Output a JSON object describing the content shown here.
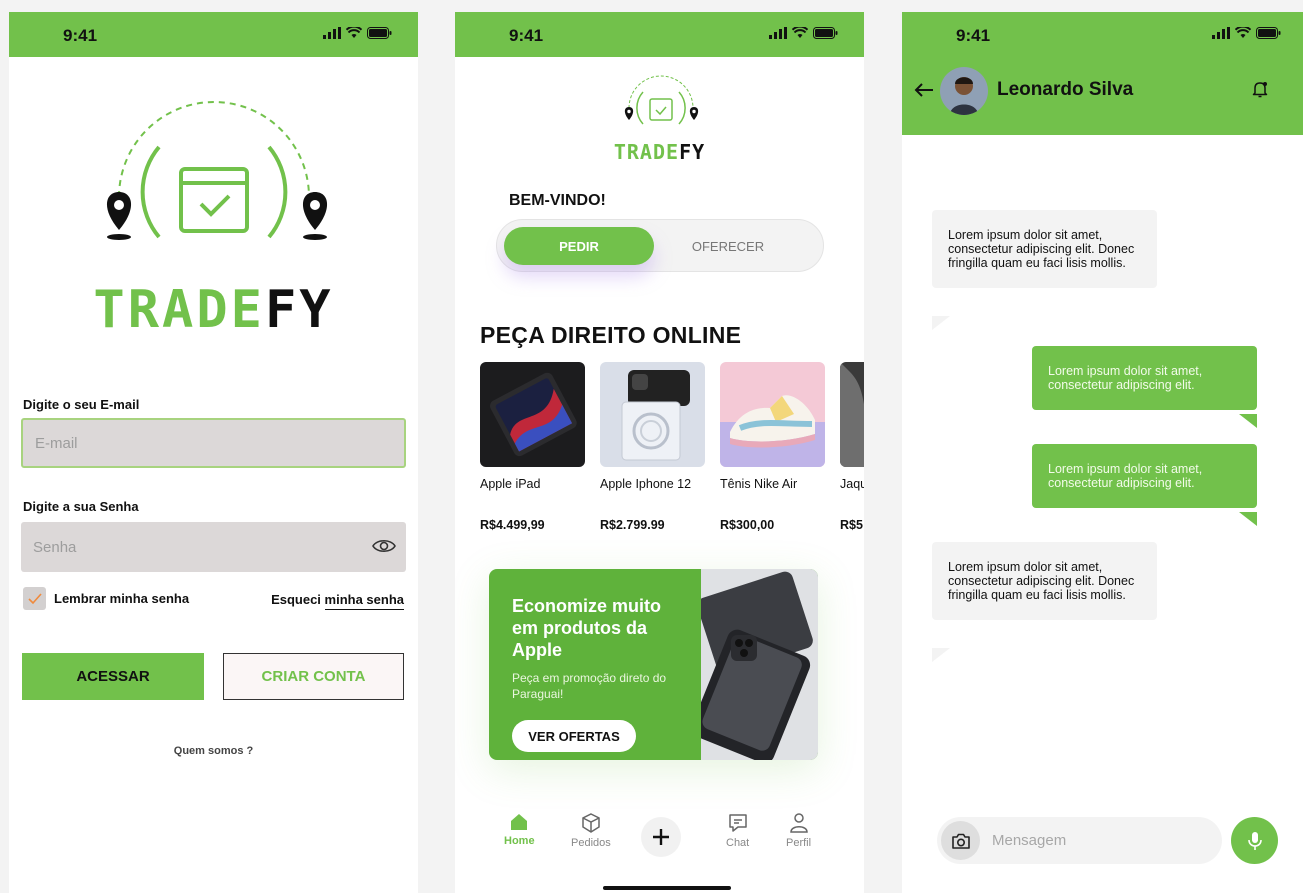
{
  "status_bar": {
    "time": "9:41"
  },
  "brand": {
    "part1": "TRADE",
    "part2": "FY"
  },
  "login": {
    "email_label": "Digite o seu E-mail",
    "email_placeholder": "E-mail",
    "password_label": "Digite a sua Senha",
    "password_placeholder": "Senha",
    "remember": "Lembrar minha senha",
    "forgot_prefix": "Esqueci ",
    "forgot_link": "minha senha",
    "access_button": "ACESSAR",
    "create_button": "CRIAR CONTA",
    "about": "Quem somos ?"
  },
  "home": {
    "welcome": "BEM-VINDO!",
    "toggle": {
      "active": "PEDIR",
      "inactive": "OFERECER"
    },
    "section_title": "PEÇA DIREITO ONLINE",
    "products": [
      {
        "name": "Apple iPad",
        "price": "R$4.499,99"
      },
      {
        "name": "Apple Iphone 12",
        "price": "R$2.799.99"
      },
      {
        "name": "Tênis Nike Air",
        "price": "R$300,00"
      },
      {
        "name": "Jaqueta Couro",
        "price": "R$5"
      }
    ],
    "banner": {
      "title": "Economize muito em produtos da Apple",
      "subtitle": "Peça em promoção direto do Paraguai!",
      "button": "VER OFERTAS"
    },
    "nav": [
      {
        "label": "Home",
        "icon": "home-icon",
        "active": true
      },
      {
        "label": "Pedidos",
        "icon": "box-icon"
      },
      {
        "label": "",
        "icon": "plus-icon"
      },
      {
        "label": "Chat",
        "icon": "chat-icon"
      },
      {
        "label": "Perfil",
        "icon": "user-icon"
      }
    ]
  },
  "chat": {
    "contact_name": "Leonardo Silva",
    "messages": [
      {
        "from": "them",
        "text": "Lorem ipsum dolor sit amet, consectetur adipiscing elit. Donec fringilla quam eu faci lisis mollis."
      },
      {
        "from": "me",
        "text": "Lorem ipsum dolor sit amet, consectetur adipiscing elit."
      },
      {
        "from": "me",
        "text": "Lorem ipsum dolor sit amet, consectetur adipiscing elit."
      },
      {
        "from": "them",
        "text": "Lorem ipsum dolor sit amet, consectetur adipiscing elit. Donec fringilla quam eu faci lisis mollis."
      }
    ],
    "input_placeholder": "Mensagem"
  },
  "colors": {
    "accent": "#72c14b",
    "field_bg": "#dcd8d8",
    "bubble_in": "#f3f3f3"
  }
}
